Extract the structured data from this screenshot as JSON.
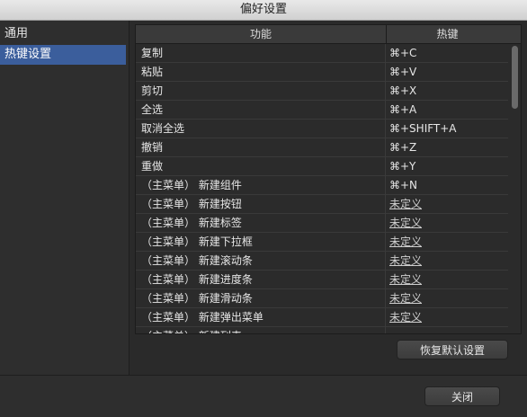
{
  "window": {
    "title": "偏好设置"
  },
  "sidebar": {
    "items": [
      {
        "label": "通用",
        "active": false
      },
      {
        "label": "热键设置",
        "active": true
      }
    ]
  },
  "table": {
    "headers": {
      "function": "功能",
      "hotkey": "热键"
    },
    "rows": [
      {
        "function": "复制",
        "hotkey": "⌘+C"
      },
      {
        "function": "粘贴",
        "hotkey": "⌘+V"
      },
      {
        "function": "剪切",
        "hotkey": "⌘+X"
      },
      {
        "function": "全选",
        "hotkey": "⌘+A"
      },
      {
        "function": "取消全选",
        "hotkey": "⌘+SHIFT+A"
      },
      {
        "function": "撤销",
        "hotkey": "⌘+Z"
      },
      {
        "function": "重做",
        "hotkey": "⌘+Y"
      },
      {
        "function": "（主菜单） 新建组件",
        "hotkey": "⌘+N"
      },
      {
        "function": "（主菜单） 新建按钮",
        "hotkey": "未定义"
      },
      {
        "function": "（主菜单） 新建标签",
        "hotkey": "未定义"
      },
      {
        "function": "（主菜单） 新建下拉框",
        "hotkey": "未定义"
      },
      {
        "function": "（主菜单） 新建滚动条",
        "hotkey": "未定义"
      },
      {
        "function": "（主菜单） 新建进度条",
        "hotkey": "未定义"
      },
      {
        "function": "（主菜单） 新建滑动条",
        "hotkey": "未定义"
      },
      {
        "function": "（主菜单） 新建弹出菜单",
        "hotkey": "未定义"
      },
      {
        "function": "（主菜单） 新建列表",
        "hotkey": ""
      }
    ]
  },
  "buttons": {
    "reset": "恢复默认设置",
    "close": "关闭"
  }
}
